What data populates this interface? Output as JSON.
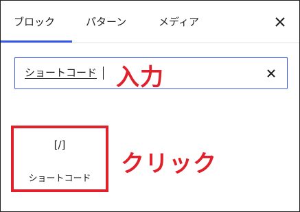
{
  "tabs": [
    {
      "label": "ブロック",
      "selected": true
    },
    {
      "label": "パターン",
      "selected": false
    },
    {
      "label": "メディア",
      "selected": false
    }
  ],
  "close_icon": "close-icon",
  "search": {
    "value": "ショートコード",
    "clear_icon": "close-icon"
  },
  "annotations": {
    "input": "入力",
    "click": "クリック",
    "color": "#e0202a"
  },
  "results": [
    {
      "icon": "[/]",
      "label": "ショートコード"
    }
  ],
  "colors": {
    "accent": "#3858e9",
    "text": "#1e1e1e"
  }
}
